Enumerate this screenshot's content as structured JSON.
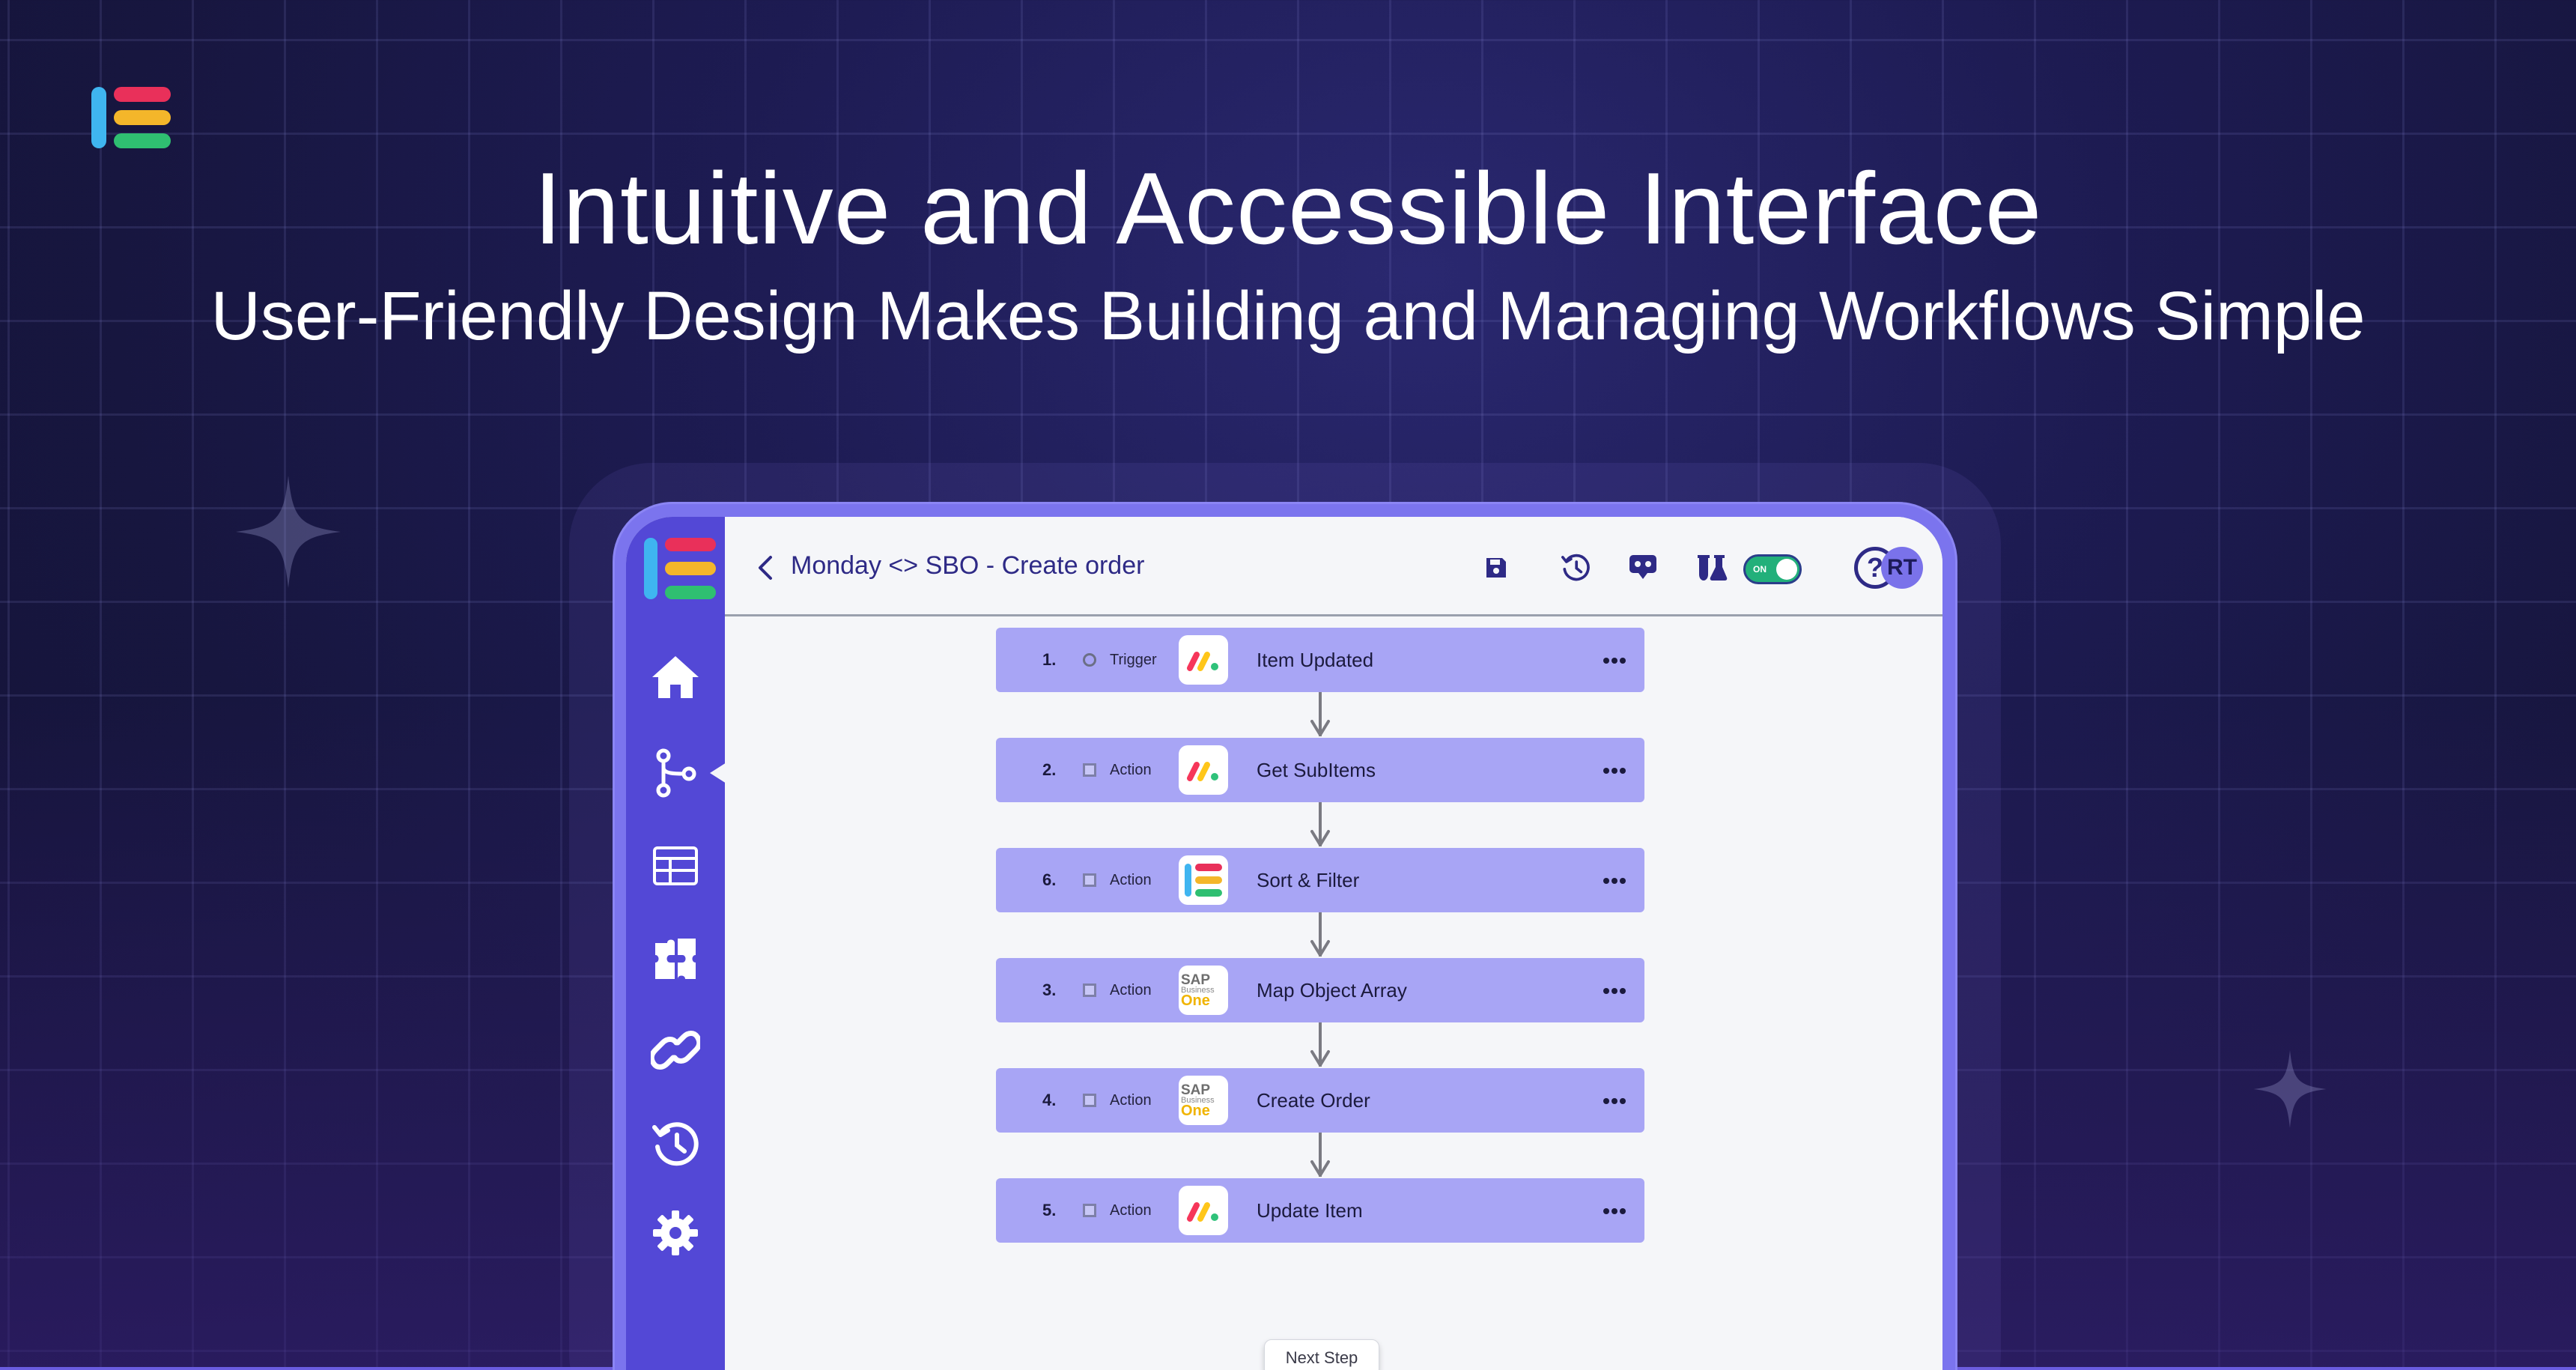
{
  "brand": {
    "logo_icon": "brand-logo-icon",
    "colors": {
      "blue": "#3fb5f0",
      "red": "#e9305a",
      "yellow": "#f4b62a",
      "green": "#2fbf71"
    }
  },
  "hero": {
    "headline": "Intuitive and Accessible Interface",
    "subheadline": "User-Friendly Design Makes Building and Managing Workflows Simple"
  },
  "app": {
    "sidebar": {
      "items": [
        {
          "id": "home",
          "icon": "home-icon"
        },
        {
          "id": "workflows",
          "icon": "workflow-branch-icon",
          "active": true
        },
        {
          "id": "tables",
          "icon": "table-icon"
        },
        {
          "id": "integrations",
          "icon": "puzzle-icon"
        },
        {
          "id": "connections",
          "icon": "link-icon"
        },
        {
          "id": "history",
          "icon": "history-icon"
        },
        {
          "id": "settings",
          "icon": "gear-icon"
        }
      ]
    },
    "topbar": {
      "title": "Monday <> SBO - Create order",
      "icons": [
        "save-icon",
        "version-history-icon",
        "test-bot-icon",
        "lab-flask-icon"
      ],
      "toggle_label": "ON",
      "help_label": "?",
      "avatar_initials": "RT"
    },
    "steps": [
      {
        "number": "1.",
        "kind": "Trigger",
        "title": "Item Updated",
        "app_icon": "monday-icon"
      },
      {
        "number": "2.",
        "kind": "Action",
        "title": "Get SubItems",
        "app_icon": "monday-icon"
      },
      {
        "number": "6.",
        "kind": "Action",
        "title": "Sort & Filter",
        "app_icon": "brand-logo-icon"
      },
      {
        "number": "3.",
        "kind": "Action",
        "title": "Map Object Array",
        "app_icon": "sap-business-one-icon"
      },
      {
        "number": "4.",
        "kind": "Action",
        "title": "Create Order",
        "app_icon": "sap-business-one-icon"
      },
      {
        "number": "5.",
        "kind": "Action",
        "title": "Update Item",
        "app_icon": "monday-icon"
      }
    ],
    "sap_logo": {
      "line1": "SAP",
      "line2": "Business",
      "line3": "One"
    },
    "next_step_label": "Next Step"
  }
}
